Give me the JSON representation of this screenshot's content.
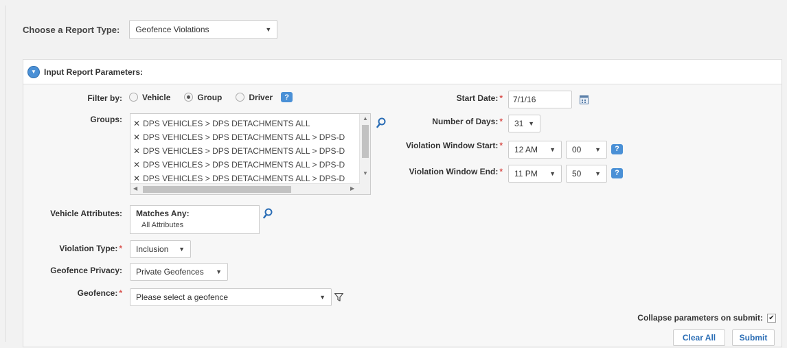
{
  "report_type": {
    "label": "Choose a Report Type:",
    "selected": "Geofence Violations"
  },
  "panel": {
    "title": "Input Report Parameters:"
  },
  "filter_by": {
    "label": "Filter by:",
    "options": [
      "Vehicle",
      "Group",
      "Driver"
    ],
    "selected": "Group"
  },
  "groups": {
    "label": "Groups:",
    "items": [
      "DPS VEHICLES > DPS DETACHMENTS ALL",
      "DPS VEHICLES > DPS DETACHMENTS ALL > DPS-D",
      "DPS VEHICLES > DPS DETACHMENTS ALL > DPS-D",
      "DPS VEHICLES > DPS DETACHMENTS ALL > DPS-D",
      "DPS VEHICLES > DPS DETACHMENTS ALL > DPS-D"
    ]
  },
  "vehicle_attributes": {
    "label": "Vehicle Attributes:",
    "heading": "Matches Any:",
    "value": "All Attributes"
  },
  "violation_type": {
    "label": "Violation Type:",
    "selected": "Inclusion"
  },
  "geofence_privacy": {
    "label": "Geofence Privacy:",
    "selected": "Private Geofences"
  },
  "geofence": {
    "label": "Geofence:",
    "placeholder": "Please select a geofence"
  },
  "start_date": {
    "label": "Start Date:",
    "value": "7/1/16"
  },
  "number_of_days": {
    "label": "Number of Days:",
    "selected": "31"
  },
  "window_start": {
    "label": "Violation Window Start:",
    "hour": "12 AM",
    "minute": "00"
  },
  "window_end": {
    "label": "Violation Window End:",
    "hour": "11 PM",
    "minute": "50"
  },
  "collapse": {
    "label": "Collapse parameters on submit:",
    "checked": true
  },
  "buttons": {
    "clear_all": "Clear All",
    "submit": "Submit"
  },
  "icons": {
    "caret": "▼",
    "remove": "✕",
    "help": "?",
    "check": "✔",
    "scroll_up": "▲",
    "scroll_down": "▼",
    "scroll_left": "◀",
    "scroll_right": "▶"
  },
  "colors": {
    "accent": "#4a90d6",
    "link": "#2a6db5",
    "required": "#d9534f"
  }
}
